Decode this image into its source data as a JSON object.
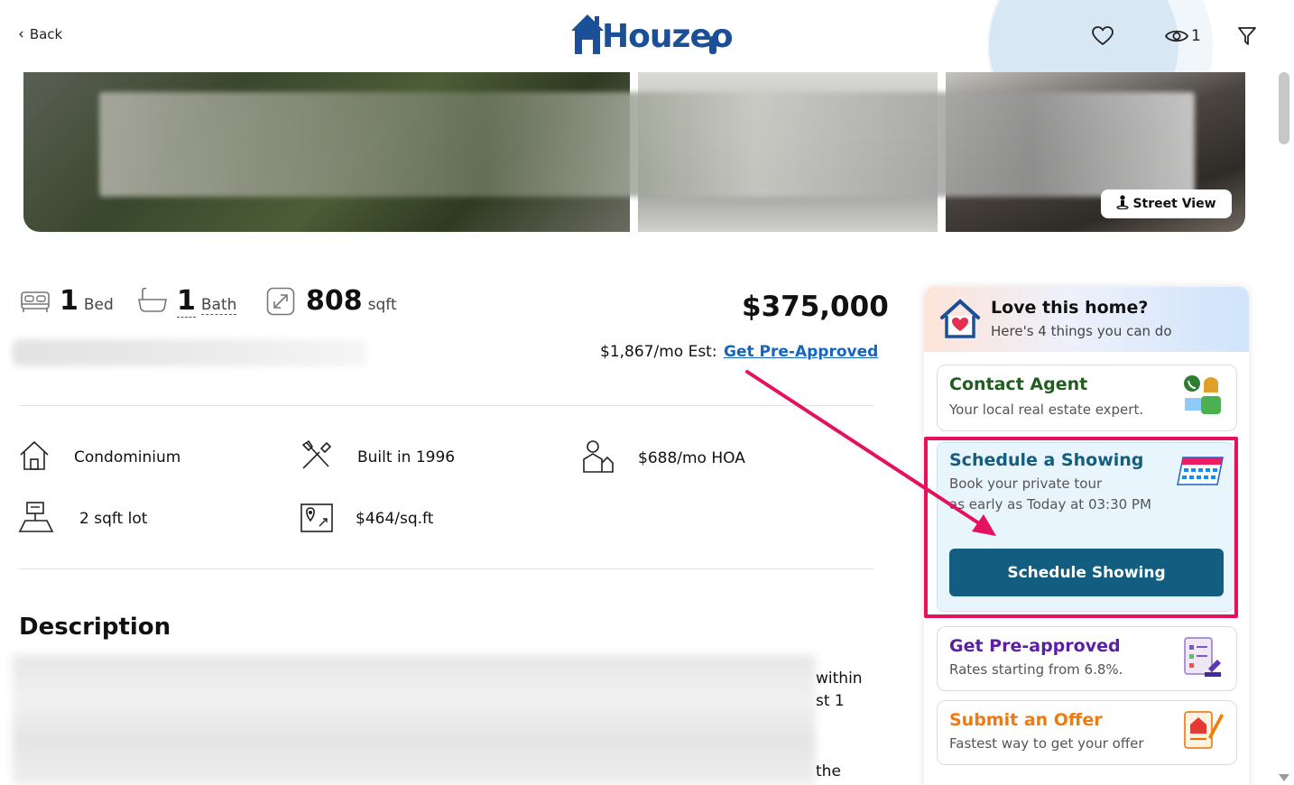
{
  "header": {
    "back_label": "Back",
    "logo_text": "Houzeo",
    "views_count": "1"
  },
  "gallery": {
    "street_view_label": "Street View"
  },
  "stats": {
    "beds_value": "1",
    "beds_unit": "Bed",
    "baths_value": "1",
    "baths_unit": "Bath",
    "area_value": "808",
    "area_unit": "sqft",
    "price": "$375,000",
    "monthly_estimate": "$1,867/mo Est:",
    "pre_approved_link": "Get Pre-Approved"
  },
  "features": [
    {
      "icon": "house-icon",
      "label": "Condominium"
    },
    {
      "icon": "tools-icon",
      "label": "Built in 1996"
    },
    {
      "icon": "hoa-icon",
      "label": "$688/mo HOA"
    },
    {
      "icon": "lot-icon",
      "label": "2 sqft lot"
    },
    {
      "icon": "map-pin-icon",
      "label": "$464/sq.ft"
    }
  ],
  "description": {
    "title": "Description",
    "fragments": [
      "within",
      "st 1",
      "the"
    ]
  },
  "panel": {
    "title": "Love this home?",
    "subtitle": "Here's 4 things you can do",
    "contact": {
      "title": "Contact Agent",
      "sub": "Your local real estate expert."
    },
    "showing": {
      "title": "Schedule a Showing",
      "sub1": "Book your private tour",
      "sub2": "as early as Today at 03:30 PM",
      "button": "Schedule Showing"
    },
    "preapproved": {
      "title": "Get Pre-approved",
      "sub": "Rates starting from 6.8%."
    },
    "offer": {
      "title": "Submit an Offer",
      "sub": "Fastest way to get your offer"
    }
  },
  "colors": {
    "brand_blue": "#1b4f97",
    "link_blue": "#1565c0",
    "contact_green": "#1f5e1f",
    "showing_teal": "#135d80",
    "preapproved_purple": "#5b1fa6",
    "offer_orange": "#f07a12",
    "highlight_pink": "#e5105e"
  }
}
